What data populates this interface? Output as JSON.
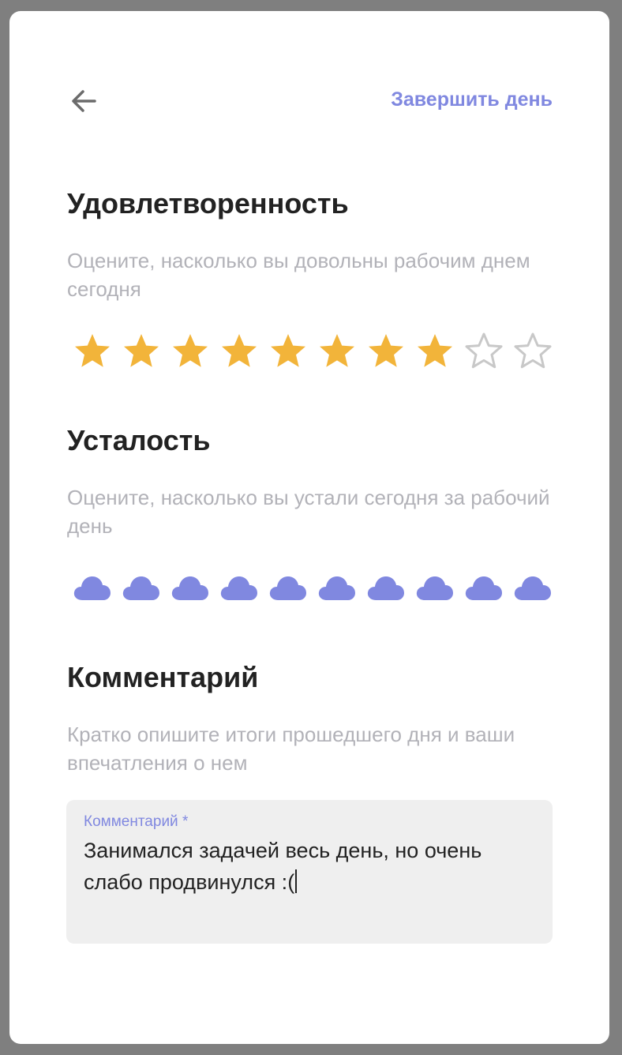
{
  "header": {
    "finish_label": "Завершить день"
  },
  "satisfaction": {
    "title": "Удовлетворенность",
    "subtitle": "Оцените, насколько вы довольны рабочим днем сегодня",
    "rating": 8,
    "max": 10
  },
  "fatigue": {
    "title": "Усталость",
    "subtitle": "Оцените, насколько вы устали сегодня за рабочий день",
    "rating": 10,
    "max": 10
  },
  "comment": {
    "title": "Комментарий",
    "subtitle": "Кратко опишите итоги прошедшего дня и ваши впечатления о нем",
    "field_label": "Комментарий *",
    "value": "Занимался задачей весь день, но очень слабо продвинулся :("
  },
  "colors": {
    "accent": "#8088e0",
    "star_filled": "#f2b43a",
    "star_empty": "#c8c8c8",
    "cloud": "#8088e0"
  }
}
